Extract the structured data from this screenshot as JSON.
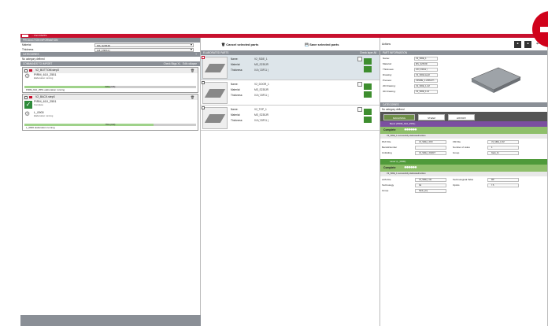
{
  "window": {
    "title": "...  Part  PARTS"
  },
  "colors": {
    "accent": "#c8102e",
    "header": "#8a8f96",
    "ok": "#2e8b3a",
    "jobpurple": "#7b4fa0",
    "jobgreen": "#4f9a3a",
    "complete": "#8fbf6b"
  },
  "production_info": {
    "header": "PRODUCTION INFORMATION",
    "material_label": "Material",
    "material_value": "MS_S235JR",
    "thickness_label": "Thickness",
    "thickness_value": "0.8 ( 33F11 )"
  },
  "categories": {
    "header": "CATEGORIES",
    "empty": "No category defined"
  },
  "commands": {
    "header": "COMMANDS TO IMPORT",
    "check_label": "Check Bkgs XL",
    "edit_label": "Edit collapse",
    "files": [
      {
        "name": "V2_BOTTOM.stepX",
        "items": [
          {
            "title": "PIRM_610_2551",
            "sub": "Elaboration running",
            "progress": "50% (2/15)",
            "icon": "gear"
          }
        ],
        "status": "PIRM_610_2551 elaboration running"
      },
      {
        "name": "V2_BACK.stepX",
        "items": [
          {
            "title": "PIRM_610_2551",
            "sub": "Complete",
            "icon": "ok"
          },
          {
            "title": "L_0900",
            "sub": "Elaboration running",
            "progress": "75% (2/10)",
            "icon": "gear"
          }
        ],
        "status": "L_0900 elaboration running"
      }
    ]
  },
  "parts": {
    "cancel_label": "Cancel selected parts",
    "save_label": "Save selected parts",
    "header": "ELABORATED PARTS",
    "check_label": "Check layer All",
    "field_labels": {
      "name": "Name:",
      "material": "Material:",
      "thickness": "Thickness:"
    },
    "items": [
      {
        "name": "V2_SIDE_1",
        "material": "MS_S235JR",
        "thickness": "0.8  ( 33F11 )"
      },
      {
        "name": "V2_DOOR_1",
        "material": "MS_S235JR",
        "thickness": "0.8  ( 33F11 )"
      },
      {
        "name": "V2_TOP_1",
        "material": "MS_S235JR",
        "thickness": "0.8  ( 33F11 )"
      }
    ]
  },
  "actions": {
    "label": "Actions"
  },
  "part_info": {
    "header": "PART INFORMATION",
    "rows": [
      {
        "label": "Name:",
        "value": "V2_SIDE_1"
      },
      {
        "label": "Material:",
        "value": "MS_S235JR"
      },
      {
        "label": "Thickness:",
        "value": "0.8  ( 33F11 )"
      },
      {
        "label": "Drawing:",
        "value": "V2_SIDE.stepX"
      },
      {
        "label": "Preview:",
        "value": "V2SIDE_1-v6Ffcxf7..."
      },
      {
        "label": "2D Drawing:",
        "value": "V2_SIDE_1.dxf"
      },
      {
        "label": "3D Drawing:",
        "value": "V2_SIDE_1.stl"
      }
    ]
  },
  "categories2": {
    "header": "CATEGORIES",
    "empty": "No category defined"
  },
  "tabs": [
    "MACHINING",
    "STEAM",
    "HISTORY"
  ],
  "jobs": [
    {
      "title": "Bend (PIRM_610_2551)",
      "status": "Complete",
      "message": "V2_SIDE_1 successfully elaborated/written",
      "fields": [
        {
          "label": "PAX File",
          "value": "V2_SIDE_1.PAX"
        },
        {
          "label": "FM File",
          "value": "V2_SIDE_1.FM"
        },
        {
          "label": "BendsNumber",
          "value": ""
        },
        {
          "label": "Number of sides",
          "value": "4"
        },
        {
          "label": "Unfolding",
          "value": "V2_SIDE_1.DRAFT"
        },
        {
          "label": "Group",
          "value": "blank_fm"
        }
      ]
    },
    {
      "title": "Laser (L_0900)",
      "status": "Complete",
      "message": "V2_SIDE_1 successfully elaborated/written",
      "fields": [
        {
          "label": "LDS File",
          "value": "V2_SIDE_1.lds"
        },
        {
          "label": "Technological Table",
          "value": "MP"
        },
        {
          "label": "Technology",
          "value": "N2"
        },
        {
          "label": "Optics",
          "value": "7.5"
        },
        {
          "label": "Group",
          "value": "blank_proj"
        }
      ]
    }
  ]
}
